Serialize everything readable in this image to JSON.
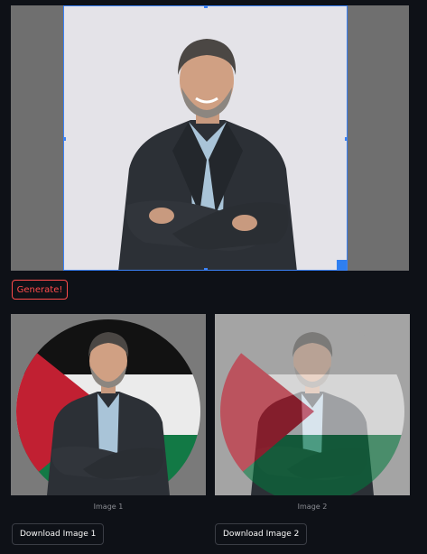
{
  "image_labels": {
    "image1": "Image 1",
    "image2": "Image 2"
  },
  "buttons": {
    "generate": "Generate!",
    "download1": "Download Image 1",
    "download2": "Download Image 2"
  },
  "colors": {
    "app_background": "#0e1117",
    "accent_red": "#ff4b4b",
    "crop_blue": "#3b82f6",
    "flag_black": "#000000",
    "flag_white": "#ffffff",
    "flag_green": "#007a3d",
    "flag_red": "#ce1126"
  }
}
